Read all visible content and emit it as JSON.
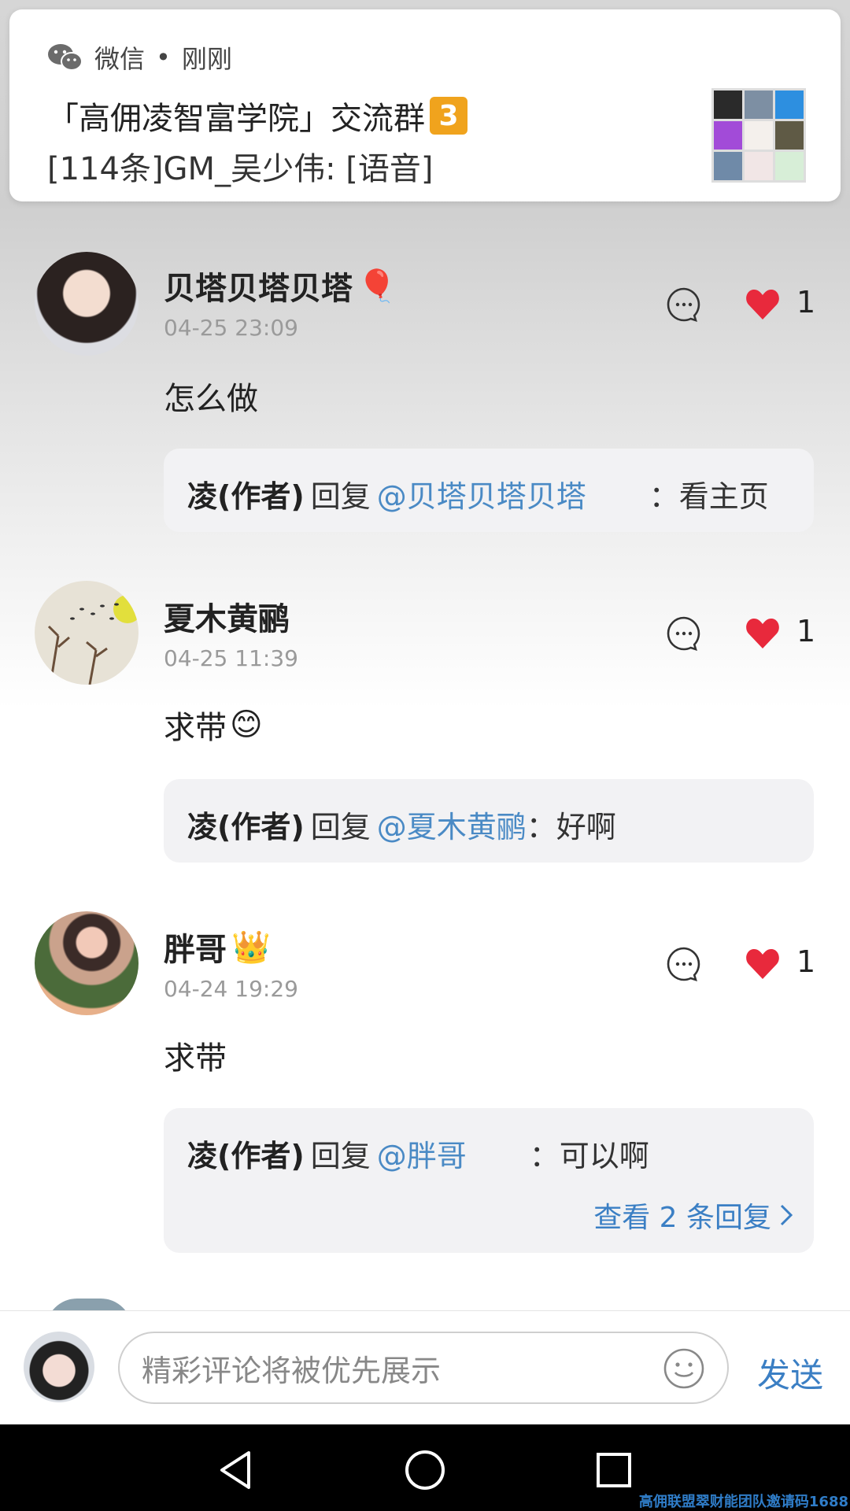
{
  "notification": {
    "app": "微信",
    "dot": "•",
    "time": "刚刚",
    "title": "「高佣凌智富学院」交流群",
    "badge": "3",
    "body": "[114条]GM_吴少伟: [语音]",
    "wechat_icon": "wechat-icon"
  },
  "comments": [
    {
      "name": "贝塔贝塔贝塔",
      "name_emoji": "🎈",
      "time": "04-25 23:09",
      "text": "怎么做",
      "likes": "1",
      "reply": {
        "author": "凌(作者)",
        "word": "回复",
        "mention": "@贝塔贝塔贝塔",
        "colon": "：",
        "text": "看主页"
      }
    },
    {
      "name": "夏木黄鹂",
      "time": "04-25 11:39",
      "text": "求带",
      "text_emoji": "😊",
      "likes": "1",
      "reply": {
        "author": "凌(作者)",
        "word": "回复",
        "mention": "@夏木黄鹂",
        "colon": "：",
        "text": "好啊"
      }
    },
    {
      "name": "胖哥",
      "name_emoji": "👑",
      "time": "04-24 19:29",
      "text": "求带",
      "likes": "1",
      "reply": {
        "author": "凌(作者)",
        "word": "回复",
        "mention": "@胖哥",
        "colon": "：",
        "text": "可以啊",
        "view_more": "查看 2 条回复"
      }
    }
  ],
  "input": {
    "placeholder": "精彩评论将被优先展示",
    "send": "发送"
  },
  "watermark": "高佣联盟翠财能团队邀请码1688",
  "colors": {
    "link": "#4a8ac5",
    "heart": "#e8293c",
    "navbar": "#000000"
  }
}
